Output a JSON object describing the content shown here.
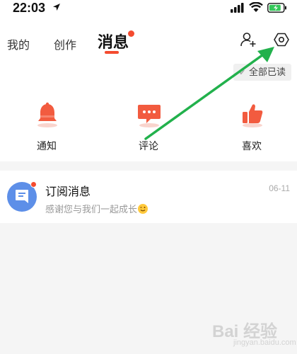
{
  "status_bar": {
    "time": "22:03"
  },
  "header": {
    "tabs": [
      {
        "label": "我的"
      },
      {
        "label": "创作"
      },
      {
        "label": "消息"
      }
    ]
  },
  "actions": {
    "mark_all_read": "全部已读"
  },
  "quick_entries": [
    {
      "label": "通知",
      "icon": "bell-icon"
    },
    {
      "label": "评论",
      "icon": "comment-icon"
    },
    {
      "label": "喜欢",
      "icon": "thumbs-up-icon"
    }
  ],
  "messages": [
    {
      "title": "订阅消息",
      "date": "06-11",
      "preview": "感谢您与我们一起成长"
    }
  ],
  "watermark": {
    "text": "Bai 经验",
    "sub": "jingyan.baidu.com"
  },
  "colors": {
    "accent": "#f44b2f",
    "annotation_arrow": "#22b14c",
    "avatar": "#5d8fe8"
  }
}
